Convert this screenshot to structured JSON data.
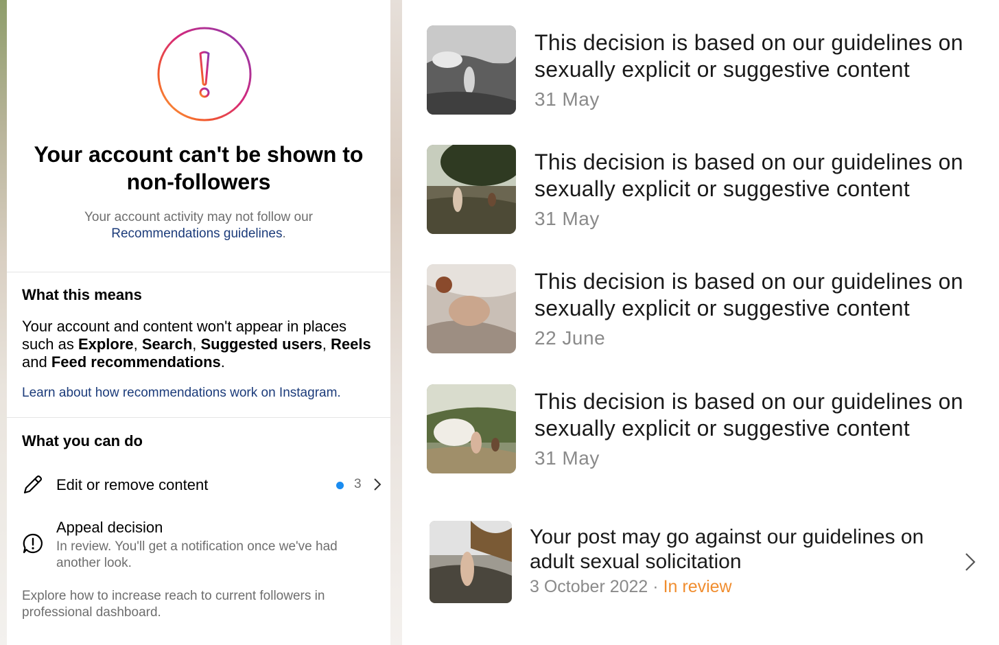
{
  "left_panel": {
    "headline": "Your account can't be shown to non-followers",
    "subtext_prefix": "Your account activity may not follow our",
    "subtext_link": "Recommendations guidelines",
    "subtext_suffix": ".",
    "what_this_means": {
      "title": "What this means",
      "body_1": "Your account and content won't appear in places such as ",
      "explore": "Explore",
      "comma_1": ", ",
      "search": "Search",
      "comma_2": ", ",
      "suggested_users": "Suggested users",
      "comma_3": ", ",
      "reels": "Reels",
      "and": " and ",
      "feed_recommendations": "Feed recommendations",
      "period": ".",
      "learn_link": "Learn about how recommendations work on Instagram."
    },
    "what_you_can_do": {
      "title": "What you can do",
      "edit_label": "Edit or remove content",
      "edit_count": "3",
      "appeal_title": "Appeal decision",
      "appeal_sub": "In review. You'll get a notification once we've had another look.",
      "explore_text": "Explore how to increase reach to current followers in professional dashboard."
    },
    "icons": {
      "warning": "exclamation-circle-icon",
      "edit": "pencil-icon",
      "appeal": "speech-exclamation-icon",
      "chevron": "chevron-right-icon"
    },
    "colors": {
      "link": "#1b3b7a",
      "dot": "#1a8cf0",
      "ring_gradient": [
        "#833ab4",
        "#c13584",
        "#fd1d1d",
        "#fcaf45"
      ]
    }
  },
  "right_panel": {
    "decisions": [
      {
        "text": "This decision is based on our guidelines on sexually explicit or suggestive content",
        "date": "31 May"
      },
      {
        "text": "This decision is based on our guidelines on sexually explicit or suggestive content",
        "date": "31 May"
      },
      {
        "text": "This decision is based on our guidelines on sexually explicit or suggestive content",
        "date": "22 June"
      },
      {
        "text": "This decision is based on our guidelines on sexually explicit or suggestive content",
        "date": "31 May"
      }
    ],
    "post": {
      "text": "Your post may go against our guidelines on adult sexual solicitation",
      "date": "3 October 2022",
      "separator": "·",
      "status": "In review"
    },
    "colors": {
      "status": "#f08d2f"
    }
  }
}
